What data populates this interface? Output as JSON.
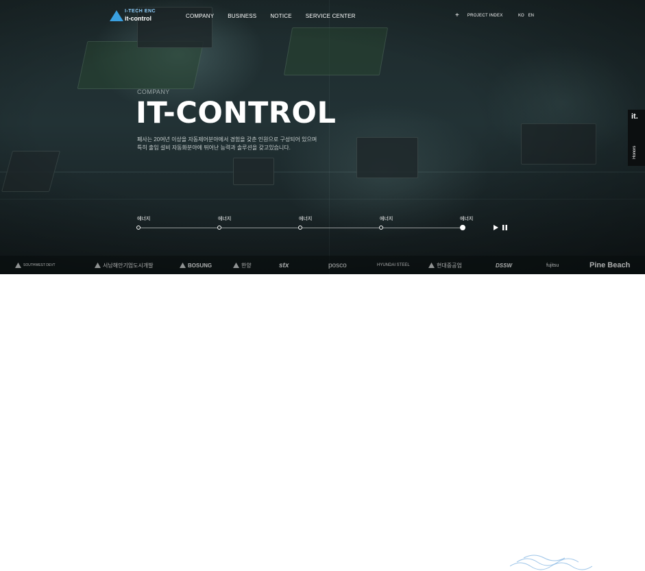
{
  "brand": {
    "line1": "I-TECH ENC",
    "line2": "it-control"
  },
  "nav": [
    "COMPANY",
    "BUSINESS",
    "NOTICE",
    "SERVICE CENTER"
  ],
  "project_index": "PROJECT INDEX",
  "languages": [
    "KO",
    "EN"
  ],
  "hero": {
    "subtitle": "COMPANY",
    "title": "IT-CONTROL",
    "desc_line1": "폐사는 20여년 이상을 자동제어분야에서 경험을 갖춘 인원으로 구성되어 있으며",
    "desc_line2": "특히 출입 설비 자동화분야에 뛰어난 능력과 솔루션을 갖고있습니다."
  },
  "steps": [
    "에너지",
    "에너지",
    "에너지",
    "에너지",
    "에너지"
  ],
  "active_step": 5,
  "side_panel": {
    "logo": "it.",
    "label": "Honors"
  },
  "partners": [
    "SOUTHWEST DEVT",
    "서남해안기업도시개발",
    "BOSUNG",
    "한양",
    "stx",
    "posco",
    "HYUNDAI STEEL",
    "현대중공업",
    "DSSW",
    "fujitsu",
    "Pine Beach"
  ]
}
